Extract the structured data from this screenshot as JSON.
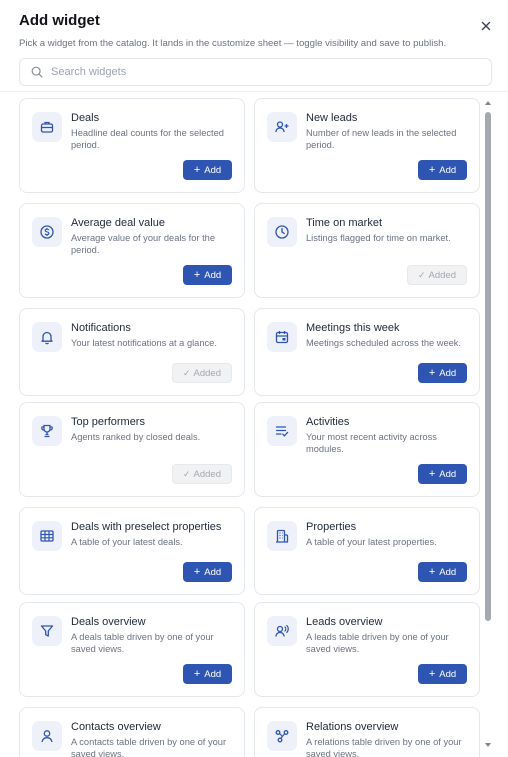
{
  "dialog": {
    "title": "Add widget",
    "subtitle": "Pick a widget from the catalog. It lands in the customize sheet — toggle visibility and save to publish."
  },
  "search": {
    "placeholder": "Search widgets",
    "value": ""
  },
  "buttons": {
    "add_label": "Add",
    "added_label": "Added"
  },
  "colors": {
    "accent": "#2f55b3",
    "icon_bg": "#eef0fa"
  },
  "widgets": [
    {
      "title": "Deals",
      "description": "Headline deal counts for the selected period.",
      "status": "add",
      "icon": "briefcase-icon"
    },
    {
      "title": "New leads",
      "description": "Number of new leads in the selected period.",
      "status": "add",
      "icon": "user-plus-icon"
    },
    {
      "title": "Average deal value",
      "description": "Average value of your deals for the period.",
      "status": "add",
      "icon": "dollar-circle-icon"
    },
    {
      "title": "Time on market",
      "description": "Listings flagged for time on market.",
      "status": "added",
      "icon": "clock-icon"
    },
    {
      "title": "Notifications",
      "description": "Your latest notifications at a glance.",
      "status": "added",
      "icon": "bell-icon"
    },
    {
      "title": "Meetings this week",
      "description": "Meetings scheduled across the week.",
      "status": "add",
      "icon": "calendar-icon"
    },
    {
      "title": "Top performers",
      "description": "Agents ranked by closed deals.",
      "status": "added",
      "icon": "trophy-icon"
    },
    {
      "title": "Activities",
      "description": "Your most recent activity across modules.",
      "status": "add",
      "icon": "list-check-icon"
    },
    {
      "title": "Deals with preselect properties",
      "description": "A table of your latest deals.",
      "status": "add",
      "icon": "table-icon"
    },
    {
      "title": "Properties",
      "description": "A table of your latest properties.",
      "status": "add",
      "icon": "building-icon"
    },
    {
      "title": "Deals overview",
      "description": "A deals table driven by one of your saved views.",
      "status": "add",
      "icon": "filter-icon"
    },
    {
      "title": "Leads overview",
      "description": "A leads table driven by one of your saved views.",
      "status": "add",
      "icon": "user-voice-icon"
    },
    {
      "title": "Contacts overview",
      "description": "A contacts table driven by one of your saved views.",
      "status": "add",
      "icon": "user-icon"
    },
    {
      "title": "Relations overview",
      "description": "A relations table driven by one of your saved views.",
      "status": "add",
      "icon": "share-icon"
    }
  ]
}
